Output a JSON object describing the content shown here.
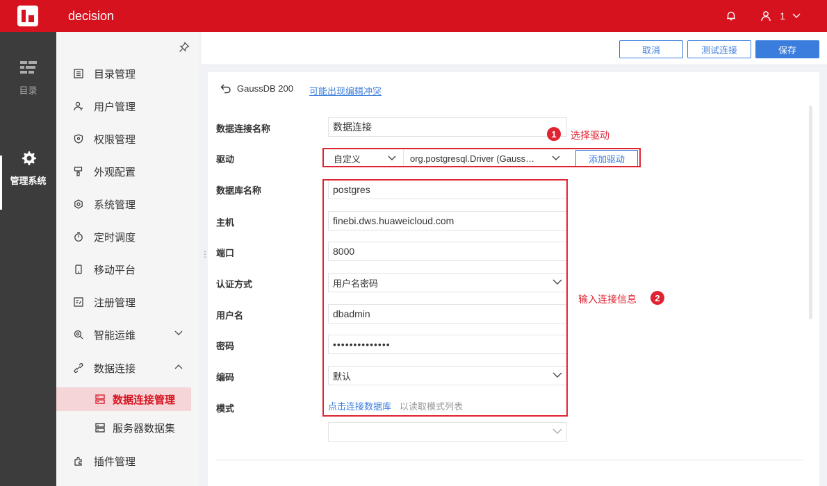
{
  "header": {
    "app_title": "decision",
    "user_name": "1"
  },
  "rail": [
    {
      "label": "目录",
      "icon": "directory-icon",
      "active": false
    },
    {
      "label": "管理系统",
      "icon": "gear-icon",
      "active": true
    }
  ],
  "sidebar": {
    "items": [
      {
        "label": "目录管理",
        "icon": "list-icon"
      },
      {
        "label": "用户管理",
        "icon": "user-icon"
      },
      {
        "label": "权限管理",
        "icon": "shield-icon"
      },
      {
        "label": "外观配置",
        "icon": "brush-icon"
      },
      {
        "label": "系统管理",
        "icon": "settings-icon"
      },
      {
        "label": "定时调度",
        "icon": "timer-icon"
      },
      {
        "label": "移动平台",
        "icon": "mobile-icon"
      },
      {
        "label": "注册管理",
        "icon": "register-icon"
      },
      {
        "label": "智能运维",
        "icon": "ops-icon"
      },
      {
        "label": "数据连接",
        "icon": "link-icon"
      }
    ],
    "sub_items": [
      {
        "label": "数据连接管理",
        "icon": "database-icon",
        "active": true
      },
      {
        "label": "服务器数据集",
        "icon": "server-dataset-icon",
        "active": false
      }
    ],
    "plugin_item": {
      "label": "插件管理",
      "icon": "plugin-icon"
    }
  },
  "toolbar": {
    "cancel_label": "取消",
    "test_label": "测试连接",
    "save_label": "保存"
  },
  "panel": {
    "back_label": "GaussDB 200",
    "conflict_link": "可能出现编辑冲突",
    "fields": {
      "conn_name_label": "数据连接名称",
      "conn_name_value": "数据连接",
      "driver_label": "驱动",
      "driver_type": "自定义",
      "driver_class": "org.postgresql.Driver (Gauss…",
      "add_driver": "添加驱动",
      "db_name_label": "数据库名称",
      "db_name_value": "postgres",
      "host_label": "主机",
      "host_value": "finebi.dws.huaweicloud.com",
      "port_label": "端口",
      "port_value": "8000",
      "auth_label": "认证方式",
      "auth_value": "用户名密码",
      "username_label": "用户名",
      "username_value": "dbadmin",
      "password_label": "密码",
      "password_value": "••••••••••••••",
      "encoding_label": "编码",
      "encoding_value": "默认",
      "mode_label": "模式",
      "mode_link": "点击连接数据库",
      "mode_hint": "以读取模式列表"
    }
  },
  "annotations": [
    {
      "badge": "1",
      "text": "选择驱动"
    },
    {
      "badge": "2",
      "text": "输入连接信息"
    }
  ],
  "colors": {
    "brand_red": "#d7121f",
    "accent_blue": "#3b7ddd",
    "annotation_red": "#e02331"
  }
}
